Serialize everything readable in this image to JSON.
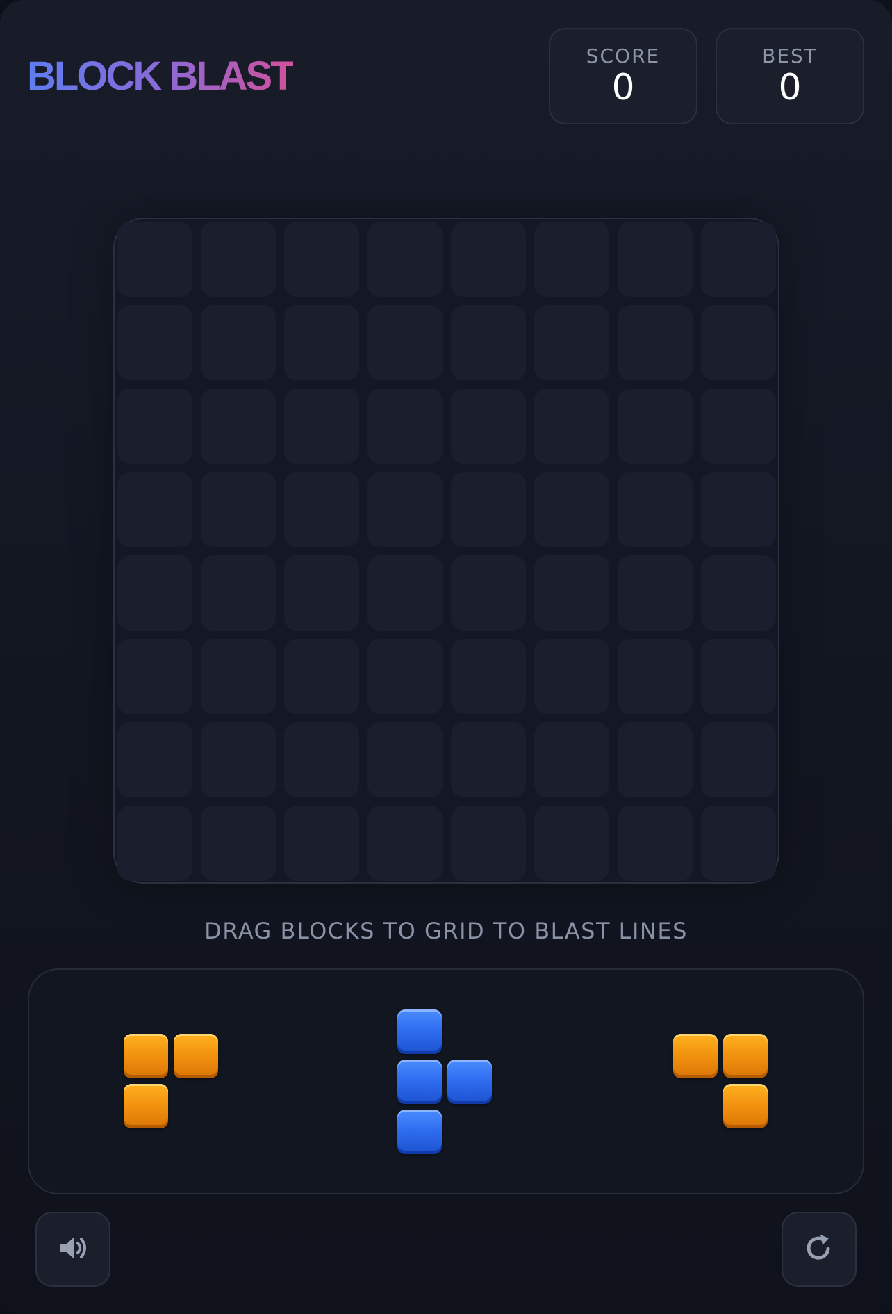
{
  "header": {
    "logo_text": "BLOCK BLAST",
    "score": {
      "label": "SCORE",
      "value": "0"
    },
    "best": {
      "label": "BEST",
      "value": "0"
    }
  },
  "board": {
    "rows": 8,
    "cols": 8,
    "filled_cells": 0
  },
  "hint_text": "DRAG BLOCKS TO GRID TO BLAST LINES",
  "tray": {
    "pieces": [
      {
        "name": "orange-corner-piece-left",
        "color": "#f39410",
        "cells": [
          [
            0,
            0
          ],
          [
            0,
            1
          ],
          [
            1,
            0
          ]
        ]
      },
      {
        "name": "blue-t-piece",
        "color": "#2f6ef0",
        "cells": [
          [
            0,
            0
          ],
          [
            1,
            0
          ],
          [
            1,
            1
          ],
          [
            2,
            0
          ]
        ]
      },
      {
        "name": "orange-corner-piece-right",
        "color": "#f39410",
        "cells": [
          [
            0,
            0
          ],
          [
            0,
            1
          ],
          [
            1,
            1
          ]
        ]
      }
    ]
  },
  "controls": {
    "sound_icon": "speaker-icon",
    "restart_icon": "restart-icon"
  },
  "colors": {
    "orange_block": "#f39410",
    "blue_block": "#2f6ef0",
    "logo_gradient_start": "#5f7df0",
    "logo_gradient_end": "#d2509a"
  }
}
